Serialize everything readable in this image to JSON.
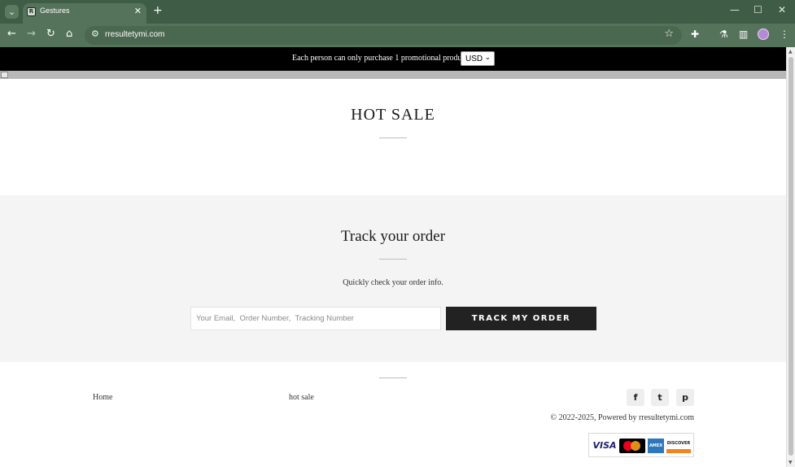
{
  "browser": {
    "tab_title": "Gestures",
    "tab_favicon_letter": "R",
    "url": "rresultetymi.com",
    "icons": {
      "tab_menu": "chevron-down-icon",
      "close": "close-icon",
      "new_tab": "plus-icon",
      "back": "arrow-left-icon",
      "forward": "arrow-right-icon",
      "reload": "reload-icon",
      "home": "home-icon",
      "site_info": "tune-icon",
      "bookmark": "star-icon",
      "extensions": "puzzle-icon",
      "labs": "flask-icon",
      "side_panel": "sidebar-icon",
      "menu": "kebab-menu-icon"
    },
    "colors": {
      "tabbar": "#3f5c46",
      "toolbar": "#55735b"
    }
  },
  "announcement": {
    "text": "Each person can only purchase 1 promotional products",
    "currency": "USD"
  },
  "hot_sale": {
    "title": "HOT SALE"
  },
  "track_order": {
    "title": "Track your order",
    "subtitle": "Quickly check your order info.",
    "input_placeholder": "Your Email,  Order Number,  Tracking Number",
    "button_label": "TRACK MY ORDER"
  },
  "footer": {
    "links": [
      {
        "label": "Home"
      },
      {
        "label": "hot sale"
      }
    ],
    "social": [
      {
        "icon": "facebook-icon",
        "glyph": "f"
      },
      {
        "icon": "twitter-icon",
        "glyph": "t"
      },
      {
        "icon": "pinterest-icon",
        "glyph": "p"
      }
    ],
    "copyright": "© 2022-2025, Powered by rresultetymi.com",
    "payments": {
      "visa": "VISA",
      "amex": "AMEX",
      "discover": "DISCOVER"
    }
  }
}
